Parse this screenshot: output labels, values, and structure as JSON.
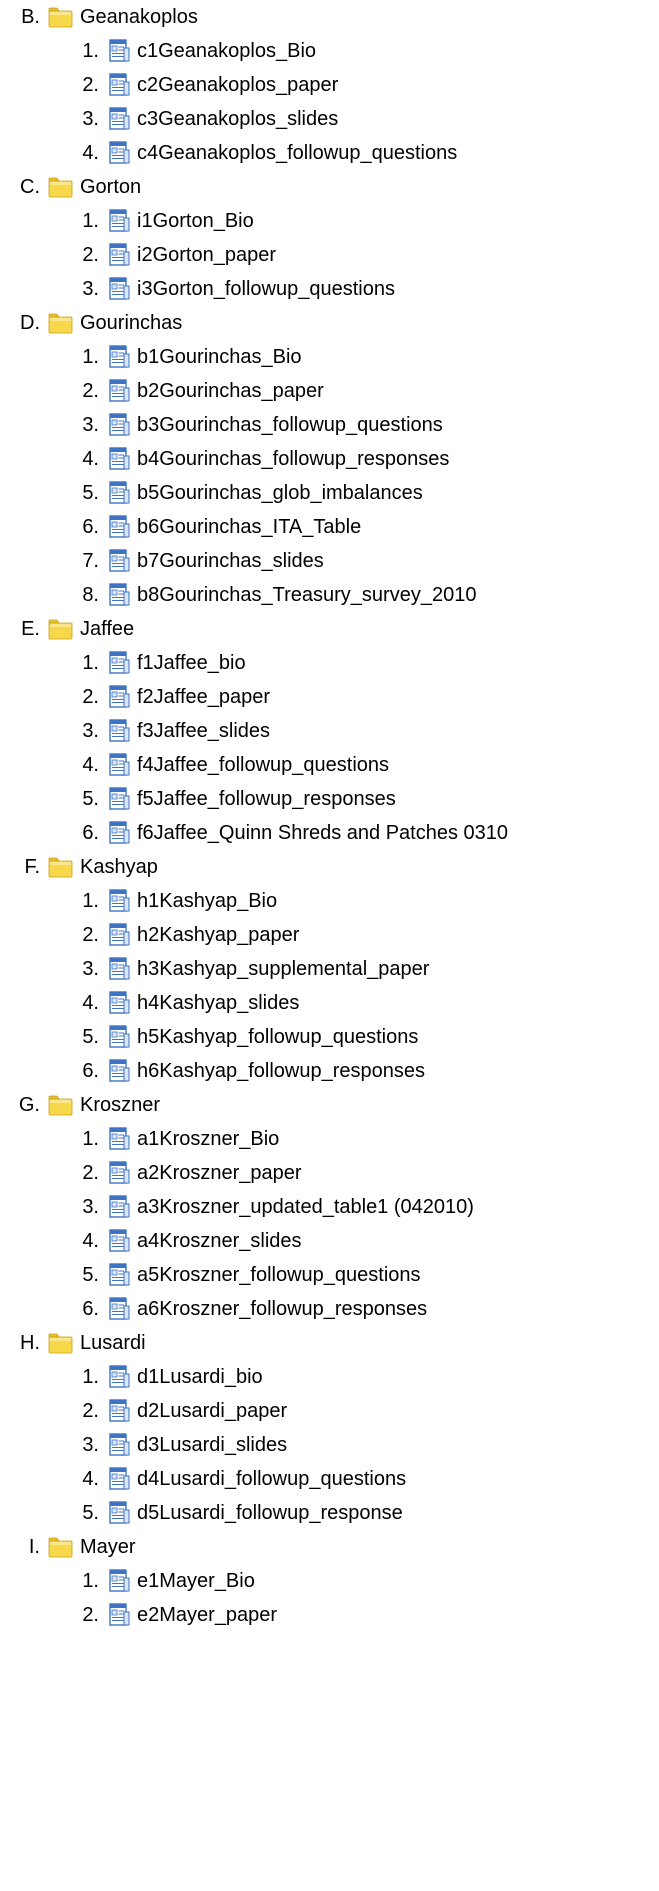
{
  "folders": [
    {
      "letter": "B.",
      "name": "Geanakoplos",
      "files": [
        "c1Geanakoplos_Bio",
        "c2Geanakoplos_paper",
        "c3Geanakoplos_slides",
        "c4Geanakoplos_followup_questions"
      ]
    },
    {
      "letter": "C.",
      "name": "Gorton",
      "files": [
        "i1Gorton_Bio",
        "i2Gorton_paper",
        "i3Gorton_followup_questions"
      ]
    },
    {
      "letter": "D.",
      "name": "Gourinchas",
      "files": [
        "b1Gourinchas_Bio",
        "b2Gourinchas_paper",
        "b3Gourinchas_followup_questions",
        "b4Gourinchas_followup_responses",
        "b5Gourinchas_glob_imbalances",
        "b6Gourinchas_ITA_Table",
        "b7Gourinchas_slides",
        "b8Gourinchas_Treasury_survey_2010"
      ]
    },
    {
      "letter": "E.",
      "name": "Jaffee",
      "files": [
        "f1Jaffee_bio",
        "f2Jaffee_paper",
        "f3Jaffee_slides",
        "f4Jaffee_followup_questions",
        "f5Jaffee_followup_responses",
        "f6Jaffee_Quinn Shreds and Patches 0310"
      ]
    },
    {
      "letter": "F.",
      "name": "Kashyap",
      "files": [
        "h1Kashyap_Bio",
        "h2Kashyap_paper",
        "h3Kashyap_supplemental_paper",
        "h4Kashyap_slides",
        "h5Kashyap_followup_questions",
        "h6Kashyap_followup_responses"
      ]
    },
    {
      "letter": "G.",
      "name": "Kroszner",
      "files": [
        "a1Kroszner_Bio",
        "a2Kroszner_paper",
        "a3Kroszner_updated_table1 (042010)",
        "a4Kroszner_slides",
        "a5Kroszner_followup_questions",
        "a6Kroszner_followup_responses"
      ]
    },
    {
      "letter": "H.",
      "name": "Lusardi",
      "files": [
        "d1Lusardi_bio",
        "d2Lusardi_paper",
        "d3Lusardi_slides",
        "d4Lusardi_followup_questions",
        "d5Lusardi_followup_response"
      ]
    },
    {
      "letter": "I.",
      "name": "Mayer",
      "files": [
        "e1Mayer_Bio",
        "e2Mayer_paper"
      ]
    }
  ],
  "icons": {
    "folder": "folder-icon",
    "document": "document-icon"
  },
  "colors": {
    "folder_fill": "#f7d84a",
    "folder_tab": "#e9c22c",
    "doc_blue": "#3f73c4",
    "doc_light": "#d8e6f8"
  }
}
